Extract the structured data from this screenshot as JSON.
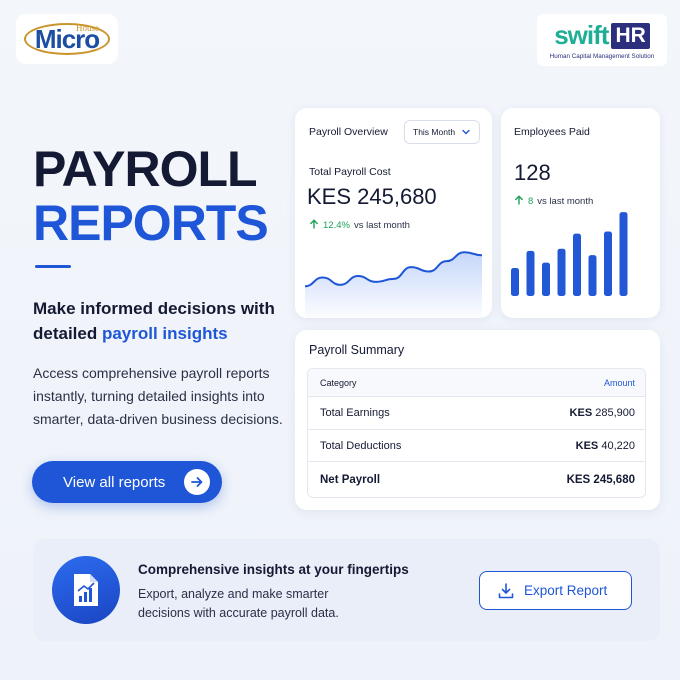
{
  "logos": {
    "micro": {
      "house": "House",
      "name": "Micro"
    },
    "swift": {
      "word": "swift",
      "hr": "HR",
      "tagline": "Human Capital Management Solution"
    }
  },
  "hero": {
    "title_line1": "PAYROLL",
    "title_line2": "REPORTS",
    "subhead_prefix": "Make informed decisions with detailed ",
    "subhead_highlight": "payroll insights",
    "description": "Access comprehensive payroll reports instantly, turning detailed insights into smarter, data-driven business decisions.",
    "cta_label": "View all reports"
  },
  "overview": {
    "title": "Payroll Overview",
    "period_select": "This Month",
    "metric_label": "Total Payroll Cost",
    "metric_value": "KES 245,680",
    "change_value": "12.4%",
    "change_suffix": "vs last month"
  },
  "employees": {
    "title": "Employees Paid",
    "value": "128",
    "change_value": "8",
    "change_suffix": "vs last month"
  },
  "summary": {
    "title": "Payroll Summary",
    "col_category": "Category",
    "col_amount": "Amount",
    "rows": [
      {
        "category": "Total Earnings",
        "currency": "KES",
        "amount": "285,900"
      },
      {
        "category": "Total Deductions",
        "currency": "KES",
        "amount": "40,220"
      },
      {
        "category": "Net Payroll",
        "currency": "KES",
        "amount": "245,680"
      }
    ]
  },
  "footer": {
    "heading": "Comprehensive insights at your fingertips",
    "text": "Export, analyze and make smarter decisions with accurate payroll data.",
    "export_label": "Export Report"
  },
  "colors": {
    "accent": "#1f56d8",
    "positive": "#1ea05a",
    "brand_teal": "#1fae95",
    "brand_navy": "#2b2f7e"
  },
  "chart_data": [
    {
      "type": "area",
      "values": [
        32,
        44,
        34,
        46,
        38,
        42,
        58,
        52,
        66,
        78,
        74
      ]
    },
    {
      "type": "bar",
      "values": [
        26,
        42,
        31,
        44,
        58,
        38,
        60,
        78
      ]
    }
  ]
}
